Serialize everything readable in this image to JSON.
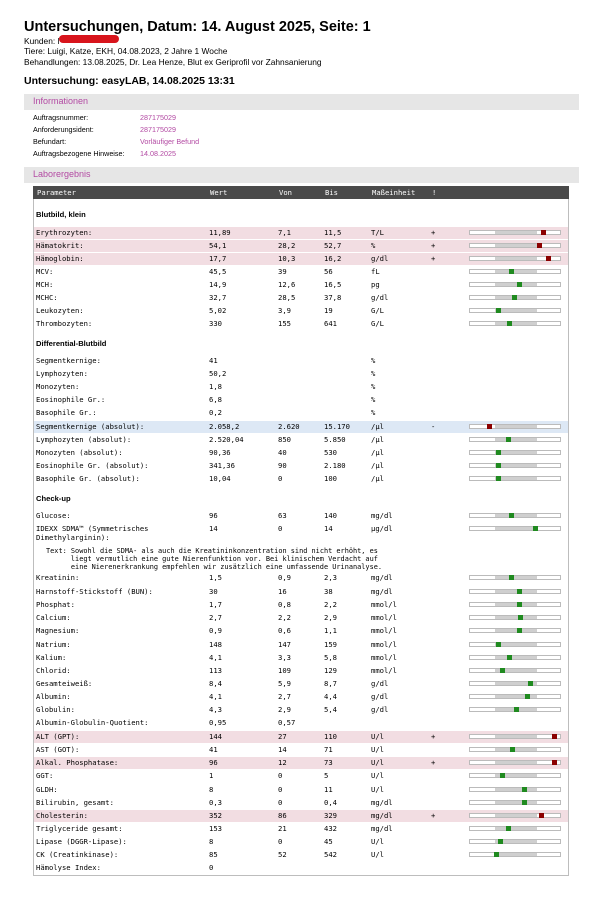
{
  "header": {
    "title": "Untersuchungen, Datum: 14. August 2025, Seite: 1",
    "kunden_label": "Kunden:",
    "kunden_value": "l",
    "tiere": "Tiere: Luigi, Katze, EKH, 04.08.2023, 2 Jahre 1 Woche",
    "behandlungen": "Behandlungen: 13.08.2025, Dr. Lea Henze, Blut ex Geriprofil vor Zahnsanierung"
  },
  "untersuchung": "Untersuchung: easyLAB, 14.08.2025 13:31",
  "info": {
    "section_title": "Informationen",
    "fields": [
      {
        "label": "Auftragsnummer:",
        "value": "287175029"
      },
      {
        "label": "Anforderungsident:",
        "value": "287175029"
      },
      {
        "label": "Befundart:",
        "value": "Vorläufiger Befund"
      },
      {
        "label": "Auftragsbezogene Hinweise:",
        "value": "14.08.2025"
      }
    ]
  },
  "lab": {
    "section_title": "Laborergebnis",
    "columns": {
      "parameter": "Parameter",
      "wert": "Wert",
      "von": "Von",
      "bis": "Bis",
      "einheit": "Maßeinheit",
      "flag": "!"
    },
    "groups": [
      {
        "title": "Blutbild, klein",
        "rows": [
          {
            "name": "Erythrozyten:",
            "wert": "11,89",
            "von": "7,1",
            "bis": "11,5",
            "einheit": "T/L",
            "flag": "+",
            "status": "high",
            "pos": 0.83
          },
          {
            "name": "Hämatokrit:",
            "wert": "54,1",
            "von": "28,2",
            "bis": "52,7",
            "einheit": "%",
            "flag": "+",
            "status": "high",
            "pos": 0.78
          },
          {
            "name": "Hämoglobin:",
            "wert": "17,7",
            "von": "10,3",
            "bis": "16,2",
            "einheit": "g/dl",
            "flag": "+",
            "status": "high",
            "pos": 0.88
          },
          {
            "name": "MCV:",
            "wert": "45,5",
            "von": "39",
            "bis": "56",
            "einheit": "fL",
            "flag": "",
            "status": "normal",
            "pos": 0.45
          },
          {
            "name": "MCH:",
            "wert": "14,9",
            "von": "12,6",
            "bis": "16,5",
            "einheit": "pg",
            "flag": "",
            "status": "normal",
            "pos": 0.55
          },
          {
            "name": "MCHC:",
            "wert": "32,7",
            "von": "28,5",
            "bis": "37,8",
            "einheit": "g/dl",
            "flag": "",
            "status": "normal",
            "pos": 0.49
          },
          {
            "name": "Leukozyten:",
            "wert": "5,02",
            "von": "3,9",
            "bis": "19",
            "einheit": "G/L",
            "flag": "",
            "status": "normal",
            "pos": 0.3
          },
          {
            "name": "Thrombozyten:",
            "wert": "330",
            "von": "155",
            "bis": "641",
            "einheit": "G/L",
            "flag": "",
            "status": "normal",
            "pos": 0.43
          }
        ]
      },
      {
        "title": "Differential-Blutbild",
        "rows": [
          {
            "name": "Segmentkernige:",
            "wert": "41",
            "von": "",
            "bis": "",
            "einheit": "%",
            "flag": "",
            "status": "none"
          },
          {
            "name": "Lymphozyten:",
            "wert": "50,2",
            "von": "",
            "bis": "",
            "einheit": "%",
            "flag": "",
            "status": "none"
          },
          {
            "name": "Monozyten:",
            "wert": "1,8",
            "von": "",
            "bis": "",
            "einheit": "%",
            "flag": "",
            "status": "none"
          },
          {
            "name": "Eosinophile Gr.:",
            "wert": "6,8",
            "von": "",
            "bis": "",
            "einheit": "%",
            "flag": "",
            "status": "none"
          },
          {
            "name": "Basophile Gr.:",
            "wert": "0,2",
            "von": "",
            "bis": "",
            "einheit": "%",
            "flag": "",
            "status": "none"
          },
          {
            "name": "Segmentkernige (absolut):",
            "wert": "2.058,2",
            "von": "2.620",
            "bis": "15.170",
            "einheit": "/µl",
            "flag": "-",
            "status": "low",
            "pos": 0.2
          },
          {
            "name": "Lymphozyten (absolut):",
            "wert": "2.520,04",
            "von": "850",
            "bis": "5.850",
            "einheit": "/µl",
            "flag": "",
            "status": "normal",
            "pos": 0.42
          },
          {
            "name": "Monozyten (absolut):",
            "wert": "90,36",
            "von": "40",
            "bis": "530",
            "einheit": "/µl",
            "flag": "",
            "status": "normal",
            "pos": 0.3
          },
          {
            "name": "Eosinophile Gr. (absolut):",
            "wert": "341,36",
            "von": "90",
            "bis": "2.180",
            "einheit": "/µl",
            "flag": "",
            "status": "normal",
            "pos": 0.3
          },
          {
            "name": "Basophile Gr. (absolut):",
            "wert": "10,04",
            "von": "0",
            "bis": "100",
            "einheit": "/µl",
            "flag": "",
            "status": "normal",
            "pos": 0.3
          }
        ]
      },
      {
        "title": "Check-up",
        "rows": [
          {
            "name": "Glucose:",
            "wert": "96",
            "von": "63",
            "bis": "140",
            "einheit": "mg/dl",
            "flag": "",
            "status": "normal",
            "pos": 0.45
          },
          {
            "name": "IDEXX SDMA™ (Symmetrisches Dimethylarginin):",
            "wert": "14",
            "von": "0",
            "bis": "14",
            "einheit": "µg/dl",
            "flag": "",
            "status": "normal",
            "pos": 0.73,
            "twoLine": true
          }
        ]
      },
      {
        "title": "",
        "rows": [
          {
            "name": "Kreatinin:",
            "wert": "1,5",
            "von": "0,9",
            "bis": "2,3",
            "einheit": "mg/dl",
            "flag": "",
            "status": "normal",
            "pos": 0.45
          },
          {
            "name": "Harnstoff-Stickstoff (BUN):",
            "wert": "30",
            "von": "16",
            "bis": "38",
            "einheit": "mg/dl",
            "flag": "",
            "status": "normal",
            "pos": 0.55
          },
          {
            "name": "Phosphat:",
            "wert": "1,7",
            "von": "0,8",
            "bis": "2,2",
            "einheit": "mmol/l",
            "flag": "",
            "status": "normal",
            "pos": 0.55
          },
          {
            "name": "Calcium:",
            "wert": "2,7",
            "von": "2,2",
            "bis": "2,9",
            "einheit": "mmol/l",
            "flag": "",
            "status": "normal",
            "pos": 0.56
          },
          {
            "name": "Magnesium:",
            "wert": "0,9",
            "von": "0,6",
            "bis": "1,1",
            "einheit": "mmol/l",
            "flag": "",
            "status": "normal",
            "pos": 0.55
          },
          {
            "name": "Natrium:",
            "wert": "148",
            "von": "147",
            "bis": "159",
            "einheit": "mmol/l",
            "flag": "",
            "status": "normal",
            "pos": 0.3
          },
          {
            "name": "Kalium:",
            "wert": "4,1",
            "von": "3,3",
            "bis": "5,8",
            "einheit": "mmol/l",
            "flag": "",
            "status": "normal",
            "pos": 0.43
          },
          {
            "name": "Chlorid:",
            "wert": "113",
            "von": "109",
            "bis": "129",
            "einheit": "mmol/l",
            "flag": "",
            "status": "normal",
            "pos": 0.35
          },
          {
            "name": "Gesamteiweiß:",
            "wert": "8,4",
            "von": "5,9",
            "bis": "8,7",
            "einheit": "g/dl",
            "flag": "",
            "status": "normal",
            "pos": 0.67
          },
          {
            "name": "Albumin:",
            "wert": "4,1",
            "von": "2,7",
            "bis": "4,4",
            "einheit": "g/dl",
            "flag": "",
            "status": "normal",
            "pos": 0.64
          },
          {
            "name": "Globulin:",
            "wert": "4,3",
            "von": "2,9",
            "bis": "5,4",
            "einheit": "g/dl",
            "flag": "",
            "status": "normal",
            "pos": 0.51
          },
          {
            "name": "Albumin-Globulin-Quotient:",
            "wert": "0,95",
            "von": "0,57",
            "bis": "",
            "einheit": "",
            "flag": "",
            "status": "none"
          },
          {
            "name": "ALT (GPT):",
            "wert": "144",
            "von": "27",
            "bis": "110",
            "einheit": "U/l",
            "flag": "+",
            "status": "high",
            "pos": 0.95
          },
          {
            "name": "AST (GOT):",
            "wert": "41",
            "von": "14",
            "bis": "71",
            "einheit": "U/l",
            "flag": "",
            "status": "normal",
            "pos": 0.47
          },
          {
            "name": "Alkal. Phosphatase:",
            "wert": "96",
            "von": "12",
            "bis": "73",
            "einheit": "U/l",
            "flag": "+",
            "status": "high",
            "pos": 0.95
          },
          {
            "name": "GGT:",
            "wert": "1",
            "von": "0",
            "bis": "5",
            "einheit": "U/l",
            "flag": "",
            "status": "normal",
            "pos": 0.35
          },
          {
            "name": "GLDH:",
            "wert": "8",
            "von": "0",
            "bis": "11",
            "einheit": "U/l",
            "flag": "",
            "status": "normal",
            "pos": 0.6
          },
          {
            "name": "Bilirubin, gesamt:",
            "wert": "0,3",
            "von": "0",
            "bis": "0,4",
            "einheit": "mg/dl",
            "flag": "",
            "status": "normal",
            "pos": 0.6
          },
          {
            "name": "Cholesterin:",
            "wert": "352",
            "von": "86",
            "bis": "329",
            "einheit": "mg/dl",
            "flag": "+",
            "status": "high",
            "pos": 0.8
          },
          {
            "name": "Triglyceride gesamt:",
            "wert": "153",
            "von": "21",
            "bis": "432",
            "einheit": "mg/dl",
            "flag": "",
            "status": "normal",
            "pos": 0.42
          },
          {
            "name": "Lipase (DGGR-Lipase):",
            "wert": "8",
            "von": "0",
            "bis": "45",
            "einheit": "U/l",
            "flag": "",
            "status": "normal",
            "pos": 0.33
          },
          {
            "name": "CK (Creatinkinase):",
            "wert": "85",
            "von": "52",
            "bis": "542",
            "einheit": "U/l",
            "flag": "",
            "status": "normal",
            "pos": 0.28
          },
          {
            "name": "Hämolyse Index:",
            "wert": "0",
            "von": "",
            "bis": "",
            "einheit": "",
            "flag": "",
            "status": "none"
          }
        ]
      }
    ],
    "note_label": "Text:",
    "note": "Sowohl die SDMA- als auch die Kreatininkonzentration sind nicht erhöht, es\n      liegt vermutlich eine gute Nierenfunktion vor. Bei klinischem Verdacht auf\n      eine Nierenerkrankung empfehlen wir zusätzlich eine umfassende Urinanalyse.",
    "colors": {
      "high_row": "#f2dde2",
      "low_row": "#dde8f5",
      "marker_normal": "#1f8a1f",
      "marker_abnormal": "#8b0000",
      "accent": "#b34aa3"
    }
  }
}
